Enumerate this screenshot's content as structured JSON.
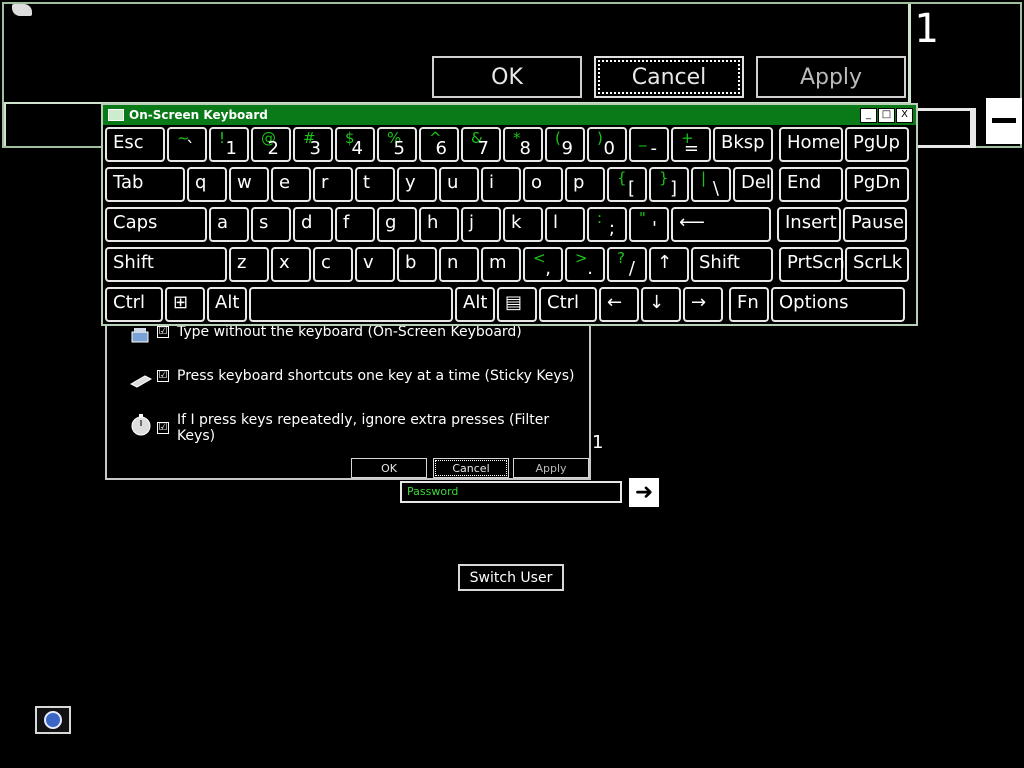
{
  "magnifier": {
    "ok_label": "OK",
    "cancel_label": "Cancel",
    "apply_label": "Apply",
    "count": "1"
  },
  "osk": {
    "title": "On-Screen Keyboard",
    "title_buttons": [
      "_",
      "□",
      "X"
    ],
    "keys": [
      {
        "main": "Esc"
      },
      {
        "shift": "~",
        "base": "`"
      },
      {
        "shift": "!",
        "base": "1"
      },
      {
        "shift": "@",
        "base": "2"
      },
      {
        "shift": "#",
        "base": "3"
      },
      {
        "shift": "$",
        "base": "4"
      },
      {
        "shift": "%",
        "base": "5"
      },
      {
        "shift": "^",
        "base": "6"
      },
      {
        "shift": "&",
        "base": "7"
      },
      {
        "shift": "*",
        "base": "8"
      },
      {
        "shift": "(",
        "base": "9"
      },
      {
        "shift": ")",
        "base": "0"
      },
      {
        "shift": "_",
        "base": "-"
      },
      {
        "shift": "+",
        "base": "="
      },
      {
        "main": "Bksp"
      },
      {
        "main": "Home"
      },
      {
        "main": "PgUp"
      },
      {
        "main": "Tab"
      },
      {
        "main": "q"
      },
      {
        "main": "w"
      },
      {
        "main": "e"
      },
      {
        "main": "r"
      },
      {
        "main": "t"
      },
      {
        "main": "y"
      },
      {
        "main": "u"
      },
      {
        "main": "i"
      },
      {
        "main": "o"
      },
      {
        "main": "p"
      },
      {
        "shift": "{",
        "base": "["
      },
      {
        "shift": "}",
        "base": "]"
      },
      {
        "shift": "|",
        "base": "\\"
      },
      {
        "main": "Del"
      },
      {
        "main": "End"
      },
      {
        "main": "PgDn"
      },
      {
        "main": "Caps"
      },
      {
        "main": "a"
      },
      {
        "main": "s"
      },
      {
        "main": "d"
      },
      {
        "main": "f"
      },
      {
        "main": "g"
      },
      {
        "main": "h"
      },
      {
        "main": "j"
      },
      {
        "main": "k"
      },
      {
        "main": "l"
      },
      {
        "shift": ":",
        "base": ";"
      },
      {
        "shift": "\"",
        "base": "'"
      },
      {
        "main": "⟵"
      },
      {
        "main": "Insert"
      },
      {
        "main": "Pause"
      },
      {
        "main": "Shift"
      },
      {
        "main": "z"
      },
      {
        "main": "x"
      },
      {
        "main": "c"
      },
      {
        "main": "v"
      },
      {
        "main": "b"
      },
      {
        "main": "n"
      },
      {
        "main": "m"
      },
      {
        "shift": "<",
        "base": ","
      },
      {
        "shift": ">",
        "base": "."
      },
      {
        "shift": "?",
        "base": "/"
      },
      {
        "main": "↑"
      },
      {
        "main": "Shift"
      },
      {
        "main": "PrtScn"
      },
      {
        "main": "ScrLk"
      },
      {
        "main": "Ctrl"
      },
      {
        "main": "⊞"
      },
      {
        "main": "Alt"
      },
      {
        "main": ""
      },
      {
        "main": "Alt"
      },
      {
        "main": "▤"
      },
      {
        "main": "Ctrl"
      },
      {
        "main": "←"
      },
      {
        "main": "↓"
      },
      {
        "main": "→"
      },
      {
        "main": "Fn"
      },
      {
        "main": "Options"
      }
    ]
  },
  "dialog": {
    "options": [
      {
        "label": "Type without the keyboard (On-Screen Keyboard)",
        "checked": "☑"
      },
      {
        "label": "Press keyboard shortcuts one key at a time (Sticky Keys)",
        "checked": "☑"
      },
      {
        "label": "If I press keys repeatedly, ignore extra presses (Filter Keys)",
        "checked": "☑"
      }
    ],
    "ok_label": "OK",
    "cancel_label": "Cancel",
    "apply_label": "Apply",
    "count": "1"
  },
  "login": {
    "password_placeholder": "Password",
    "go_arrow": "➜",
    "switch_user_label": "Switch User"
  }
}
